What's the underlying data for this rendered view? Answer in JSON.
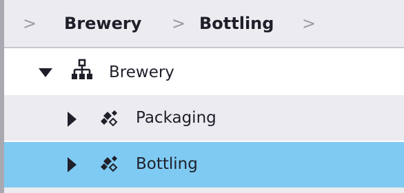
{
  "breadcrumb": {
    "items": [
      "Brewery",
      "Bottling"
    ],
    "separator": ">"
  },
  "tree": {
    "root": {
      "label": "Brewery",
      "expanded": true,
      "icon": "hierarchy-icon"
    },
    "children": [
      {
        "label": "Packaging",
        "expanded": false,
        "selected": false,
        "icon": "asset-diamonds-icon"
      },
      {
        "label": "Bottling",
        "expanded": false,
        "selected": true,
        "icon": "asset-diamonds-icon"
      }
    ]
  },
  "colors": {
    "selected_row": "#7fcaf2",
    "alt_row": "#ebebf0",
    "breadcrumb_bg": "#ebebf0",
    "text": "#1f1f2a"
  }
}
